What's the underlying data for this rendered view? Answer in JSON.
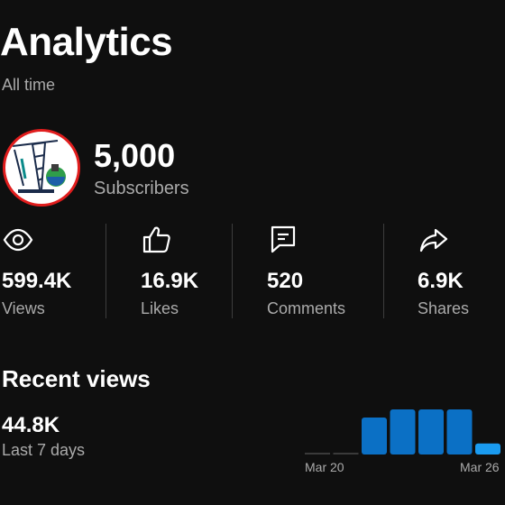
{
  "header": {
    "title": "Analytics",
    "period": "All time"
  },
  "channel": {
    "subscribers_value": "5,000",
    "subscribers_label": "Subscribers"
  },
  "stats": [
    {
      "icon": "eye-icon",
      "value": "599.4K",
      "label": "Views"
    },
    {
      "icon": "thumbs-up-icon",
      "value": "16.9K",
      "label": "Likes"
    },
    {
      "icon": "comment-icon",
      "value": "520",
      "label": "Comments"
    },
    {
      "icon": "share-icon",
      "value": "6.9K",
      "label": "Shares"
    }
  ],
  "recent": {
    "title": "Recent views",
    "value": "44.8K",
    "label": "Last 7 days"
  },
  "chart_data": {
    "type": "bar",
    "categories": [
      "",
      "",
      "",
      "",
      "",
      "",
      "",
      ""
    ],
    "values": [
      0.05,
      0.05,
      1.0,
      1.22,
      1.22,
      1.22,
      0.3
    ],
    "x_tick_labels": [
      "Mar 20",
      "Mar 26"
    ],
    "colors": {
      "muted": "#3a3a3a",
      "highlight": "#0b70c5",
      "current": "#1a9bf0"
    }
  }
}
